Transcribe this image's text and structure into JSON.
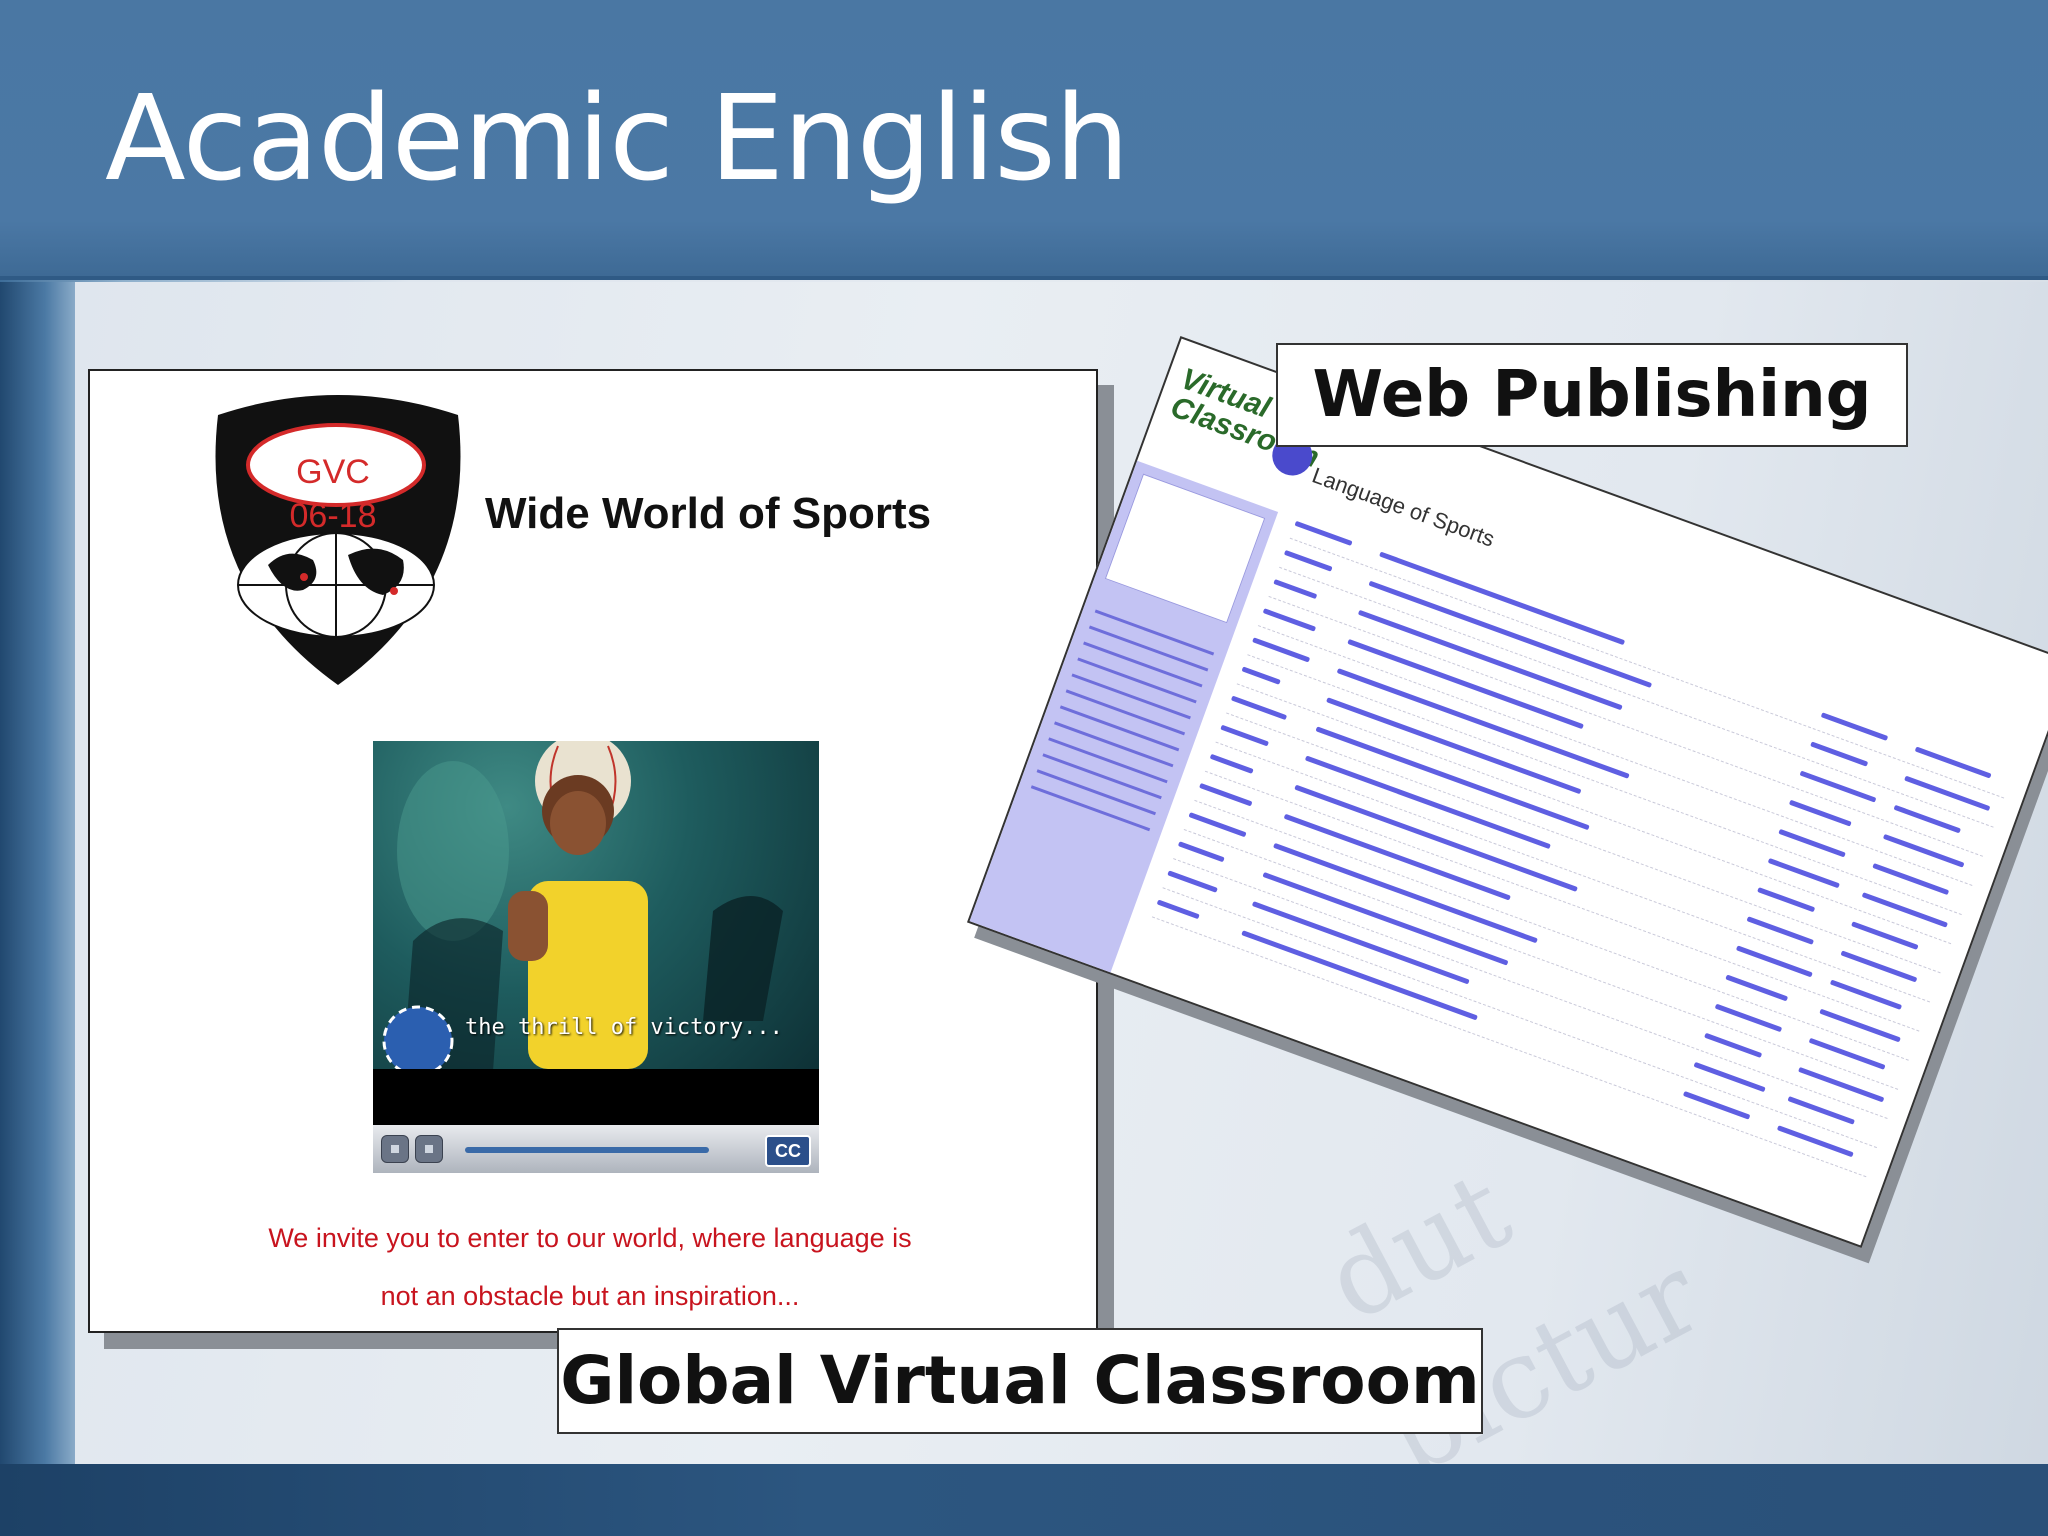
{
  "slide": {
    "title": "Academic English"
  },
  "gvc_screenshot": {
    "shield_label": "GVC 06-18",
    "heading": "Wide World of Sports",
    "video_caption": "the thrill of victory...",
    "cc_button": "CC",
    "invite_line1": "We invite you to enter to our world, where language is",
    "invite_line2": "not an obstacle but an inspiration..."
  },
  "web_screenshot": {
    "logo_line1": "Virtual",
    "logo_line2": "Classroom",
    "page_title": "Language of Sports"
  },
  "labels": {
    "web_publishing": "Web Publishing",
    "global_virtual_classroom": "Global Virtual Classroom"
  },
  "colors": {
    "header_blue": "#4b78a5",
    "invite_red": "#c8141e",
    "sidebar_lavender": "#c3c3f3",
    "link_blue": "#2a2ad8"
  }
}
